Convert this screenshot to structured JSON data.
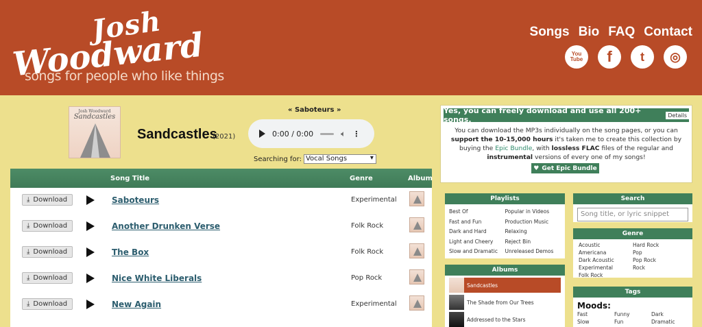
{
  "header": {
    "logo_line1": "Josh",
    "logo_line2": "Woodward",
    "tagline": "songs for people who like things",
    "nav": [
      "Songs",
      "Bio",
      "FAQ",
      "Contact"
    ],
    "social": {
      "youtube": "You Tube",
      "facebook": "f",
      "twitter": "t",
      "instagram": "◎"
    }
  },
  "now": {
    "cover_artist": "Josh Woodward",
    "cover_title": "Sandcastles",
    "album_title": "Sandcastles",
    "album_year": "(2021)",
    "current_song": "« Saboteurs »",
    "time": "0:00 / 0:00",
    "searching_label": "Searching for:",
    "searching_value": "Vocal Songs"
  },
  "table": {
    "headers": {
      "title": "Song Title",
      "genre": "Genre",
      "album": "Album"
    },
    "download_label": "Download",
    "rows": [
      {
        "title": "Saboteurs",
        "genre": "Experimental"
      },
      {
        "title": "Another Drunken Verse",
        "genre": "Folk Rock"
      },
      {
        "title": "The Box",
        "genre": "Folk Rock"
      },
      {
        "title": "Nice White Liberals",
        "genre": "Pop Rock"
      },
      {
        "title": "New Again",
        "genre": "Experimental"
      }
    ]
  },
  "info": {
    "heading": "Yes, you can freely download and use all 200+ songs.",
    "details": "Details",
    "text_a": "You can download the MP3s individually on the song pages, or you can ",
    "text_b": "support the 10-15,000 hours",
    "text_c": " it's taken me to create this collection by buying the ",
    "text_d": "Epic Bundle",
    "text_e": ", with ",
    "text_f": "lossless FLAC",
    "text_g": " files of the regular and ",
    "text_h": "instrumental",
    "text_i": " versions of every one of my songs!",
    "epic_button": "Get Epic Bundle"
  },
  "playlists": {
    "title": "Playlists",
    "col1": [
      "Best Of",
      "Fast and Fun",
      "Dark and Hard",
      "Light and Cheery",
      "Slow and Dramatic"
    ],
    "col2": [
      "Popular in Videos",
      "Production Music",
      "Relaxing",
      "Reject Bin",
      "Unreleased Demos"
    ]
  },
  "albums": {
    "title": "Albums",
    "items": [
      "Sandcastles",
      "The Shade from Our Trees",
      "Addressed to the Stars"
    ]
  },
  "search": {
    "title": "Search",
    "placeholder": "Song title, or lyric snippet"
  },
  "genre": {
    "title": "Genre",
    "col1": [
      "Acoustic",
      "Americana",
      "Dark Acoustic",
      "Experimental",
      "Folk Rock"
    ],
    "col2": [
      "Hard Rock",
      "Pop",
      "Pop Rock",
      "Rock"
    ]
  },
  "tags": {
    "title": "Tags",
    "moods_label": "Moods:",
    "col1": [
      "Fast",
      "Slow"
    ],
    "col2": [
      "Funny",
      "Fun"
    ],
    "col3": [
      "Dark",
      "Dramatic"
    ]
  },
  "colors": {
    "header": "#b84b27",
    "page": "#ede08d",
    "green": "#3f7f5a",
    "link": "#2c5d6e"
  }
}
